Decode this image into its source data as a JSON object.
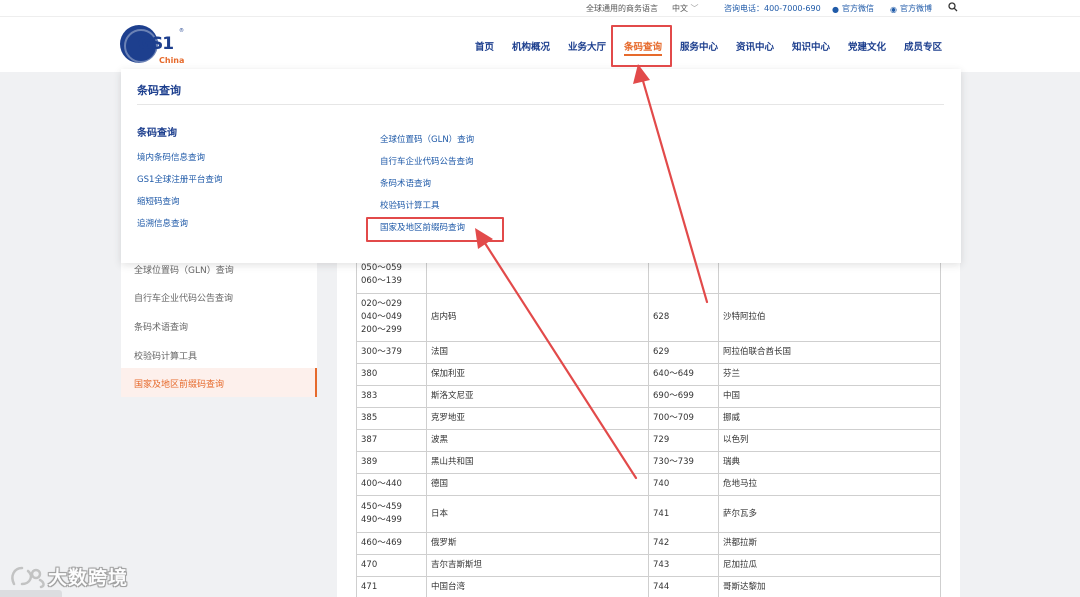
{
  "topbar": {
    "slogan": "全球通用的商务语言",
    "language": "中文",
    "phone": "咨询电话：400-7000-690",
    "wechat": "官方微信",
    "weibo": "官方微博"
  },
  "logo": {
    "brand": "GS1",
    "sub": "China",
    "reg": "®"
  },
  "nav": {
    "home": "首页",
    "about": "机构概况",
    "business": "业务大厅",
    "barcode": "条码查询",
    "service": "服务中心",
    "news": "资讯中心",
    "knowledge": "知识中心",
    "party": "党建文化",
    "members": "成员专区"
  },
  "dropdown": {
    "title": "条码查询",
    "col_title": "条码查询",
    "left_links": [
      "境内条码信息查询",
      "GS1全球注册平台查询",
      "缩短码查询",
      "追溯信息查询"
    ],
    "right_links": [
      "全球位置码（GLN）查询",
      "自行车企业代码公告查询",
      "条码术语查询",
      "校验码计算工具",
      "国家及地区前缀码查询"
    ]
  },
  "sidebar": {
    "items": [
      "全球位置码（GLN）查询",
      "自行车企业代码公告查询",
      "条码术语查询",
      "校验码计算工具",
      "国家及地区前缀码查询"
    ]
  },
  "table": {
    "rows": [
      [
        "050～059\n060～139",
        "",
        "",
        ""
      ],
      [
        "020～029\n040～049\n200～299",
        "店内码",
        "628",
        "沙特阿拉伯"
      ],
      [
        "300～379",
        "法国",
        "629",
        "阿拉伯联合酋长国"
      ],
      [
        "380",
        "保加利亚",
        "640～649",
        "芬兰"
      ],
      [
        "383",
        "斯洛文尼亚",
        "690～699",
        "中国"
      ],
      [
        "385",
        "克罗地亚",
        "700～709",
        "挪威"
      ],
      [
        "387",
        "波黑",
        "729",
        "以色列"
      ],
      [
        "389",
        "黑山共和国",
        "730～739",
        "瑞典"
      ],
      [
        "400～440",
        "德国",
        "740",
        "危地马拉"
      ],
      [
        "450～459\n490～499",
        "日本",
        "741",
        "萨尔瓦多"
      ],
      [
        "460～469",
        "俄罗斯",
        "742",
        "洪都拉斯"
      ],
      [
        "470",
        "吉尔吉斯斯坦",
        "743",
        "尼加拉瓜"
      ],
      [
        "471",
        "中国台湾",
        "744",
        "哥斯达黎加"
      ]
    ]
  },
  "watermark": {
    "text": "大数跨境"
  },
  "colors": {
    "brand_blue": "#1d3f8e",
    "accent_orange": "#e66a2c",
    "annotation_red": "#e24a4a"
  }
}
